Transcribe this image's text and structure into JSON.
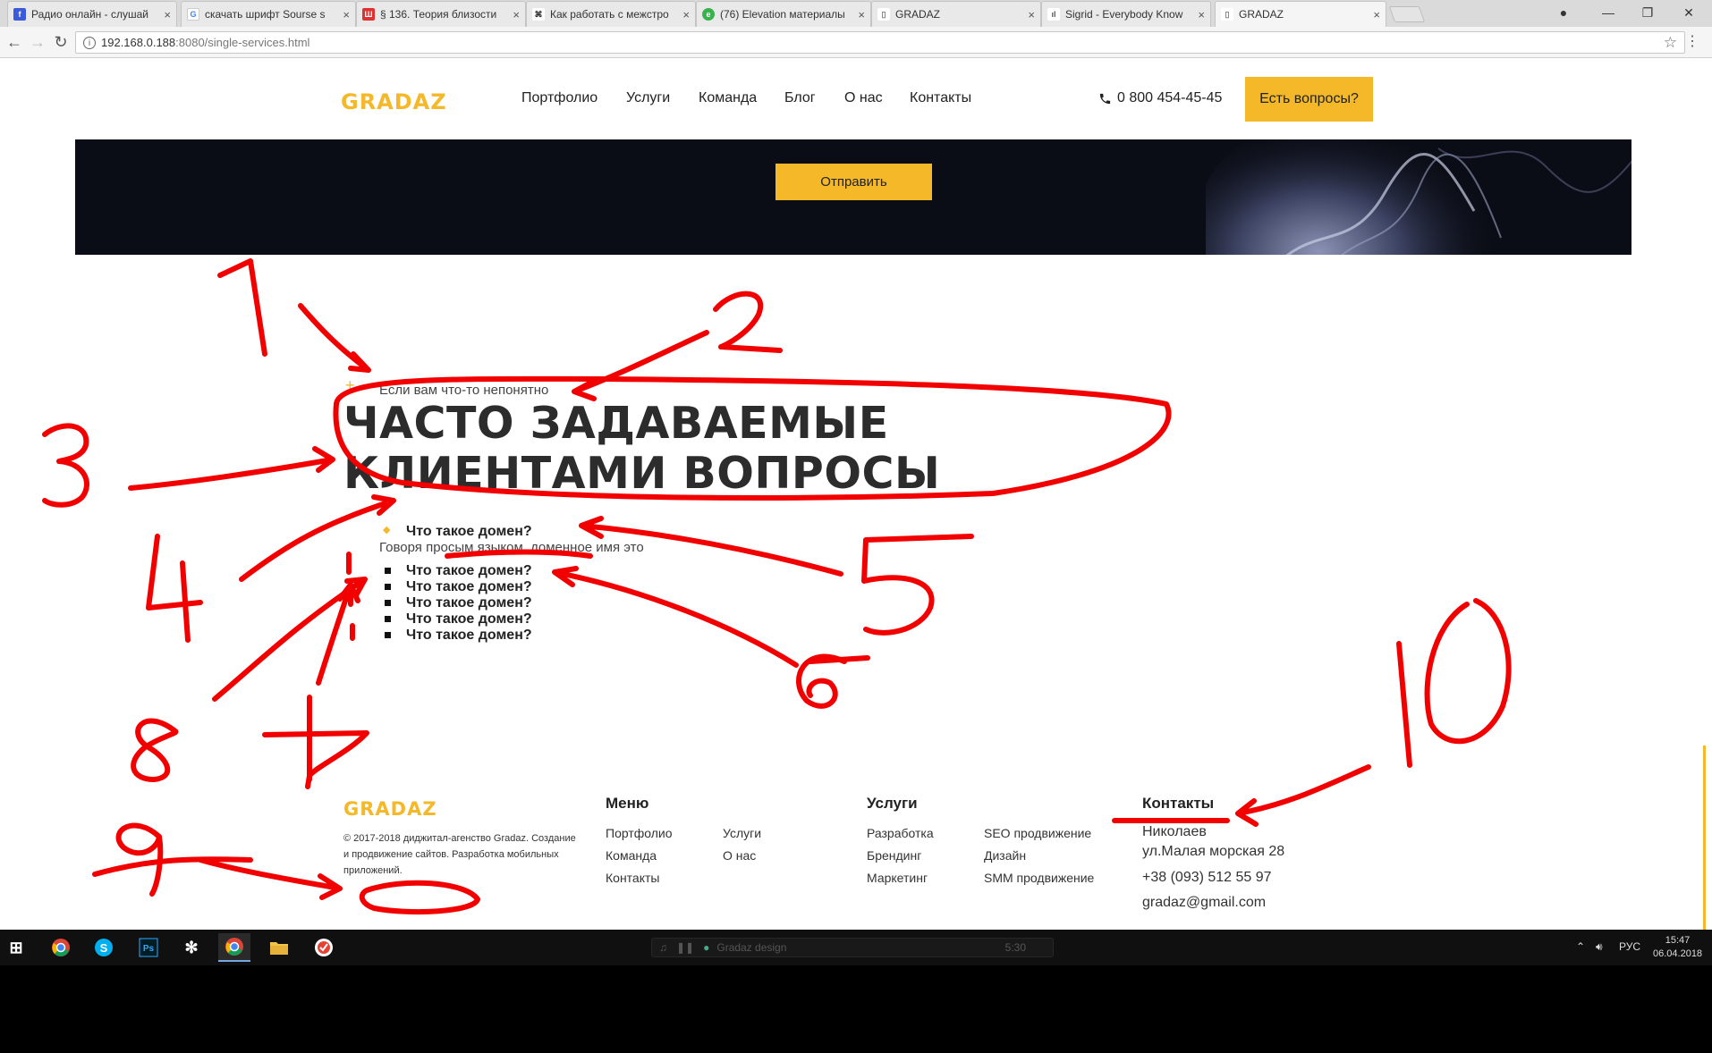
{
  "browser": {
    "tabs": [
      {
        "label": "Радио онлайн - слушай",
        "fav_color": "#3b5bdb",
        "fav_text": "f"
      },
      {
        "label": "скачать шрифт Sourse s",
        "fav_color": "#ffffff",
        "fav_text": "G"
      },
      {
        "label": "§ 136. Теория близости",
        "fav_color": "#e03131",
        "fav_text": "Ш"
      },
      {
        "label": "Как работать с межстро",
        "fav_color": "#ffffff",
        "fav_text": "⌘"
      },
      {
        "label": "(76) Elevation материалы",
        "fav_color": "#37b24d",
        "fav_text": "e"
      },
      {
        "label": "GRADAZ",
        "fav_color": "#ffffff",
        "fav_text": "▯"
      },
      {
        "label": "Sigrid - Everybody Know",
        "fav_color": "#ffffff",
        "fav_text": "ıl"
      },
      {
        "label": "GRADAZ",
        "fav_color": "#ffffff",
        "fav_text": "▯"
      }
    ],
    "close_glyph": "×",
    "url_host": "192.168.0.188",
    "url_rest": ":8080/single-services.html",
    "win_controls": [
      "●",
      "—",
      "❐",
      "✕"
    ]
  },
  "header": {
    "logo": "GRADAZ",
    "nav": [
      "Портфолио",
      "Услуги",
      "Команда",
      "Блог",
      "О нас",
      "Контакты"
    ],
    "phone_icon": "phone-icon",
    "phone": "0 800 454-45-45",
    "cta": "Есть вопросы?"
  },
  "banner": {
    "send_button": "Отправить"
  },
  "faq": {
    "subtitle": "Если вам что-то непонятно",
    "title": "ЧАСТО ЗАДАВАЕМЫЕ КЛИЕНТАМИ ВОПРОСЫ",
    "open_question": "Что такое домен?",
    "open_answer": "Говоря просым языком, доменное имя это",
    "questions": [
      "Что такое домен?",
      "Что такое домен?",
      "Что такое домен?",
      "Что такое домен?",
      "Что такое домен?"
    ]
  },
  "footer": {
    "logo": "GRADAZ",
    "copyright": "© 2017-2018 диджитал-агенство Gradaz. Создание и продвижение сайтов. Разработка мобильных приложений.",
    "menu": {
      "heading": "Меню",
      "links": [
        "Портфолио",
        "Услуги",
        "Команда",
        "О нас",
        "Контакты"
      ]
    },
    "services": {
      "heading": "Услуги",
      "links": [
        "Разработка",
        "SEO продвижение",
        "Брендинг",
        "Дизайн",
        "Маркетинг",
        "SMM продвижение"
      ]
    },
    "contacts": {
      "heading": "Контакты",
      "city": "Николаев",
      "street": "ул.Малая морская 28",
      "phone": "+38 (093) 512 55 97",
      "email": "gradaz@gmail.com"
    }
  },
  "taskbar": {
    "media_title": "Gradaz design",
    "media_time": "5:30",
    "lang": "РУС",
    "time": "15:47",
    "date": "06.04.2018"
  },
  "annotations": {
    "numbers": [
      "1",
      "2",
      "3",
      "4",
      "5",
      "6",
      "7",
      "8",
      "9",
      "10"
    ],
    "color": "#f20000"
  }
}
